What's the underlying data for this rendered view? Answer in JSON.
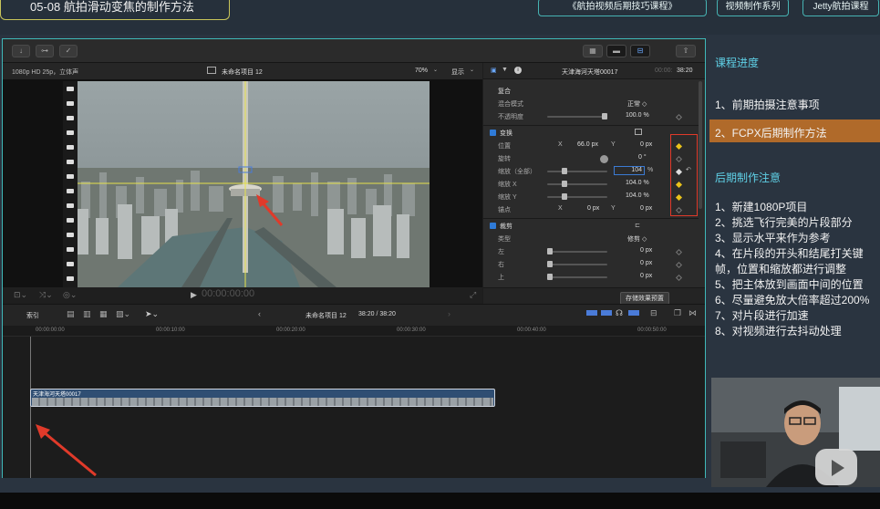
{
  "course": {
    "lesson_title": "05-08 航拍滑动变焦的制作方法",
    "tags": [
      "《航拍视频后期技巧课程》",
      "视频制作系列",
      "Jetty航拍课程"
    ]
  },
  "viewer": {
    "format": "1080p HD 25p，立体声",
    "project": "未命名项目 12",
    "zoom": "70%",
    "display_label": "显示",
    "timecode": "00:00:00:00"
  },
  "inspector": {
    "clip_name": "天津海河天塔00017",
    "time_prefix": "00:00:",
    "time": "38:20",
    "composite_title": "复合",
    "blend_mode_label": "混合模式",
    "blend_mode_value": "正常 ◇",
    "opacity_label": "不透明度",
    "opacity_value": "100.0 %",
    "transform_title": "变换",
    "position_label": "位置",
    "position_x_label": "X",
    "position_x": "66.0 px",
    "position_y_label": "Y",
    "position_y": "0 px",
    "rotation_label": "旋转",
    "rotation_value": "0 °",
    "scale_all_label": "缩放（全部）",
    "scale_all_value": "104",
    "scale_all_unit": "%",
    "scale_x_label": "缩放 X",
    "scale_x_value": "104.0 %",
    "scale_y_label": "缩放 Y",
    "scale_y_value": "104.0 %",
    "anchor_label": "锚点",
    "anchor_x_label": "X",
    "anchor_x": "0 px",
    "anchor_y_label": "Y",
    "anchor_y": "0 px",
    "crop_title": "裁剪",
    "crop_type_label": "类型",
    "crop_type_value": "修剪 ◇",
    "left_label": "左",
    "left_value": "0 px",
    "right_label": "右",
    "right_value": "0 px",
    "top_label": "上",
    "top_value": "0 px",
    "save_preset": "存储效果预置"
  },
  "timeline": {
    "index_label": "索引",
    "project_label": "未命名项目 12",
    "duration": "38:20 / 38:20",
    "ruler": [
      "00:00:00:00",
      "00:00:10:00",
      "00:00:20:00",
      "00:00:30:00",
      "00:00:40:00",
      "00:00:50:00"
    ],
    "clip_name": "天津海河天塔00017"
  },
  "sidebar": {
    "progress_title": "课程进度",
    "progress_items": [
      "1、前期拍摄注意事项",
      "2、FCPX后期制作方法"
    ],
    "notes_title": "后期制作注意",
    "notes": [
      "1、新建1080P项目",
      "2、挑选飞行完美的片段部分",
      "3、显示水平来作为参考",
      "4、在片段的开头和结尾打关键",
      "帧，位置和缩放都进行调整",
      "5、把主体放到画面中间的位置",
      "6、尽量避免放大倍率超过200%",
      "7、对片段进行加速",
      "8、对视频进行去抖动处理"
    ]
  },
  "colors": {
    "accent_teal": "#3fb8b8",
    "highlight_orange": "#b06a2a",
    "keyframe_yellow": "#e9c21a",
    "annotation_red": "#e03a2a"
  }
}
